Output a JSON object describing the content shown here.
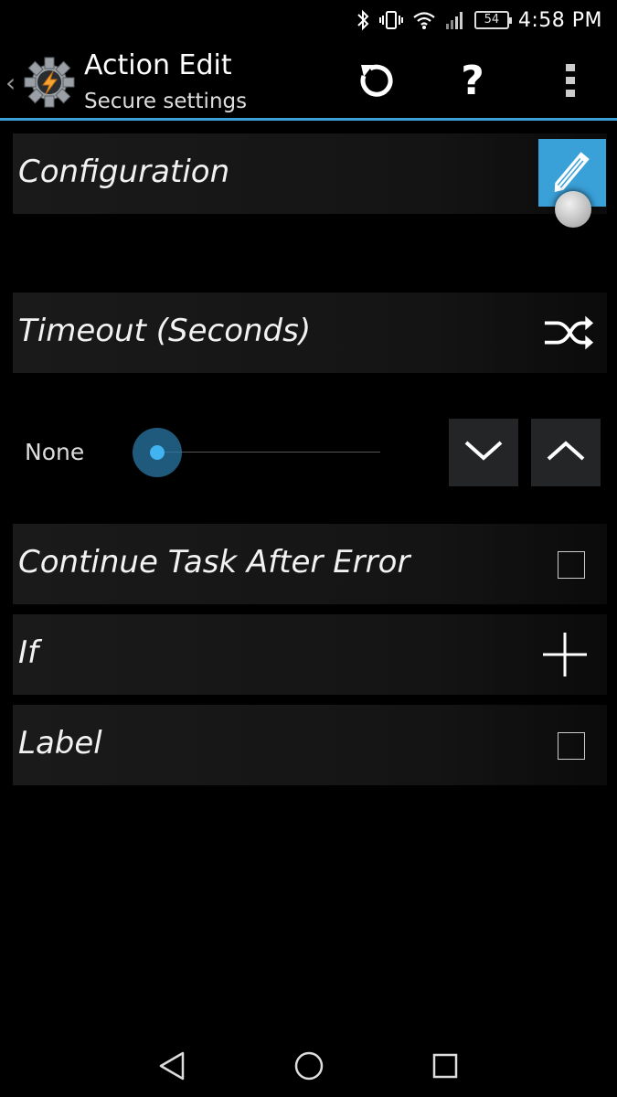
{
  "status_bar": {
    "battery_level": "54",
    "time": "4:58 PM",
    "icons": [
      "bluetooth-icon",
      "vibrate-icon",
      "wifi-icon",
      "signal-icon",
      "battery-icon"
    ]
  },
  "action_bar": {
    "title": "Action Edit",
    "subtitle": "Secure settings",
    "help_glyph": "?",
    "icons": [
      "back-chevron-icon",
      "tasker-logo-icon",
      "undo-icon",
      "help-icon",
      "overflow-menu-icon"
    ]
  },
  "rows": {
    "configuration": {
      "label": "Configuration"
    },
    "timeout": {
      "label": "Timeout (Seconds)"
    },
    "continue_after_error": {
      "label": "Continue Task After Error",
      "checked": false
    },
    "if": {
      "label": "If"
    },
    "label": {
      "label": "Label",
      "checked": false
    }
  },
  "timeout_slider": {
    "value_text": "None",
    "position_fraction": 0
  },
  "colors": {
    "accent": "#3aa0d8",
    "slider_thumb": "#41b3f0",
    "background": "#000000"
  }
}
